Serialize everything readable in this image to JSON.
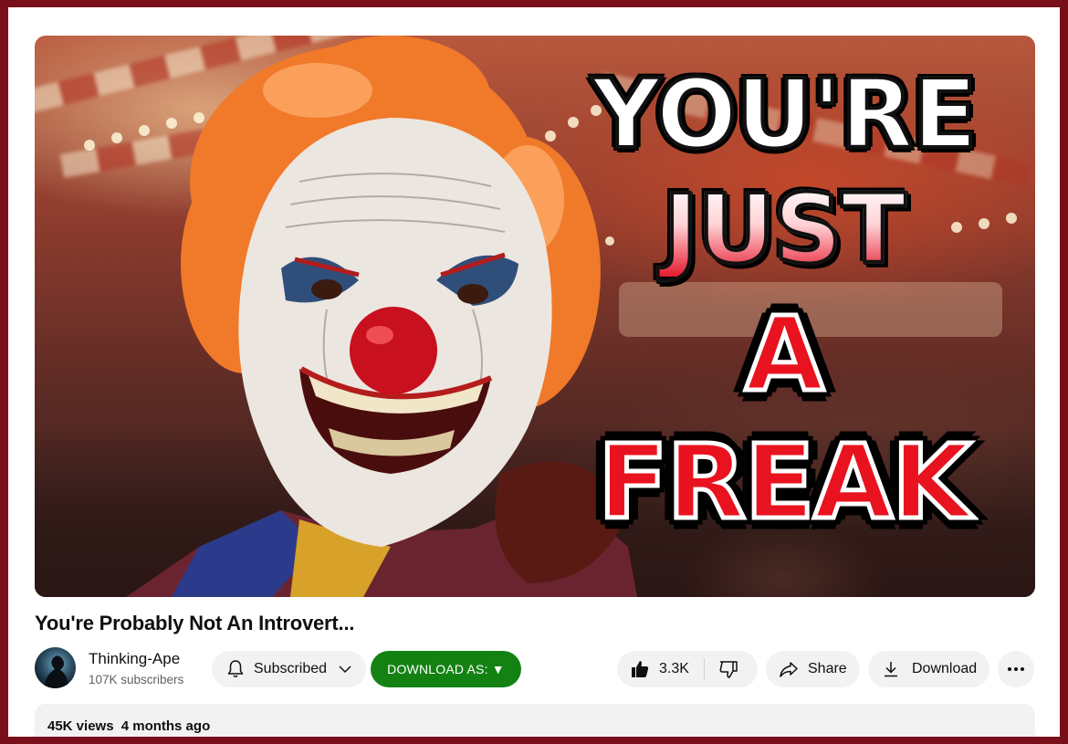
{
  "thumbnail": {
    "headline_line1": "YOU'RE",
    "headline_line2": "JUST",
    "headline_line3": "A",
    "headline_line4": "FREAK"
  },
  "video": {
    "title": "You're Probably Not An Introvert...",
    "views": "45K views",
    "age": "4 months ago"
  },
  "channel": {
    "name": "Thinking-Ape",
    "subscribers": "107K subscribers"
  },
  "actions": {
    "subscribe_label": "Subscribed",
    "download_as_label": "DOWNLOAD AS: ▼",
    "like_count": "3.3K",
    "share_label": "Share",
    "download_label": "Download"
  },
  "icons": [
    "bell-icon",
    "chevron-down-icon",
    "thumbs-up-icon",
    "thumbs-down-icon",
    "share-arrow-icon",
    "download-icon",
    "more-options-icon"
  ],
  "colors": {
    "frame_border": "#7a0f1c",
    "download_as_button": "#138213",
    "pill_background": "#f2f2f2",
    "headline_red": "#e8131f"
  }
}
